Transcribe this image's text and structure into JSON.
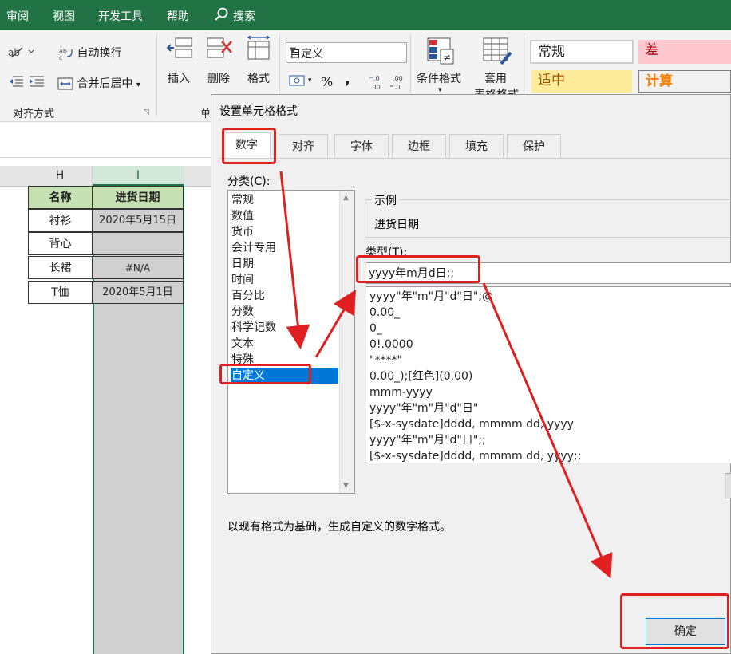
{
  "menu": [
    "审阅",
    "视图",
    "开发工具",
    "帮助",
    "搜索"
  ],
  "ribbon": {
    "wrap_text": "自动换行",
    "merge_center": "合并后居中",
    "align_group": "对齐方式",
    "insert": "插入",
    "delete": "删除",
    "format": "格式",
    "cells_group_partial": "单",
    "number_format": "自定义",
    "percent": "%",
    "comma": ",",
    "cond_format": "条件格式",
    "table_format_1": "套用",
    "table_format_2": "表格格式",
    "styles": [
      {
        "label": "常规",
        "bg": "#ffffff",
        "color": "#222222"
      },
      {
        "label": "差",
        "bg": "#ffc7ce",
        "color": "#9c0006"
      },
      {
        "label": "适中",
        "bg": "#ffeb9c",
        "color": "#9c5700"
      },
      {
        "label": "计算",
        "bg": "#f2f2f2",
        "color": "#fa7d00"
      }
    ]
  },
  "sheet": {
    "col_h": "H",
    "col_i": "I",
    "header": [
      "名称",
      "进货日期"
    ],
    "rows": [
      [
        "衬衫",
        "2020年5月15日"
      ],
      [
        "背心",
        ""
      ],
      [
        "长裙",
        "#N/A"
      ],
      [
        "T恤",
        "2020年5月1日"
      ]
    ]
  },
  "dialog": {
    "title": "设置单元格格式",
    "tabs": [
      "数字",
      "对齐",
      "字体",
      "边框",
      "填充",
      "保护"
    ],
    "category_label": "分类(C):",
    "categories": [
      "常规",
      "数值",
      "货币",
      "会计专用",
      "日期",
      "时间",
      "百分比",
      "分数",
      "科学记数",
      "文本",
      "特殊",
      "自定义"
    ],
    "selected_category": "自定义",
    "sample_label": "示例",
    "sample_value": "进货日期",
    "type_label": "类型(T):",
    "type_value": "yyyy年m月d日;;",
    "formats": [
      "yyyy\"年\"m\"月\"d\"日\";@",
      "0.00_",
      "0_",
      "0!.0000",
      "\"****\"",
      "0.00_);[红色](0.00)",
      "mmm-yyyy",
      "yyyy\"年\"m\"月\"d\"日\"",
      "[$-x-sysdate]dddd, mmmm dd, yyyy",
      "yyyy\"年\"m\"月\"d\"日\";;",
      "[$-x-sysdate]dddd, mmmm dd, yyyy;;"
    ],
    "description": "以现有格式为基础，生成自定义的数字格式。",
    "ok": "确定"
  },
  "colors": {
    "excel_green": "#217346",
    "select_blue": "#0078d7",
    "annotation_red": "#e02020",
    "header_green": "#c6e0b4",
    "column_gray": "#d0d0d0"
  }
}
